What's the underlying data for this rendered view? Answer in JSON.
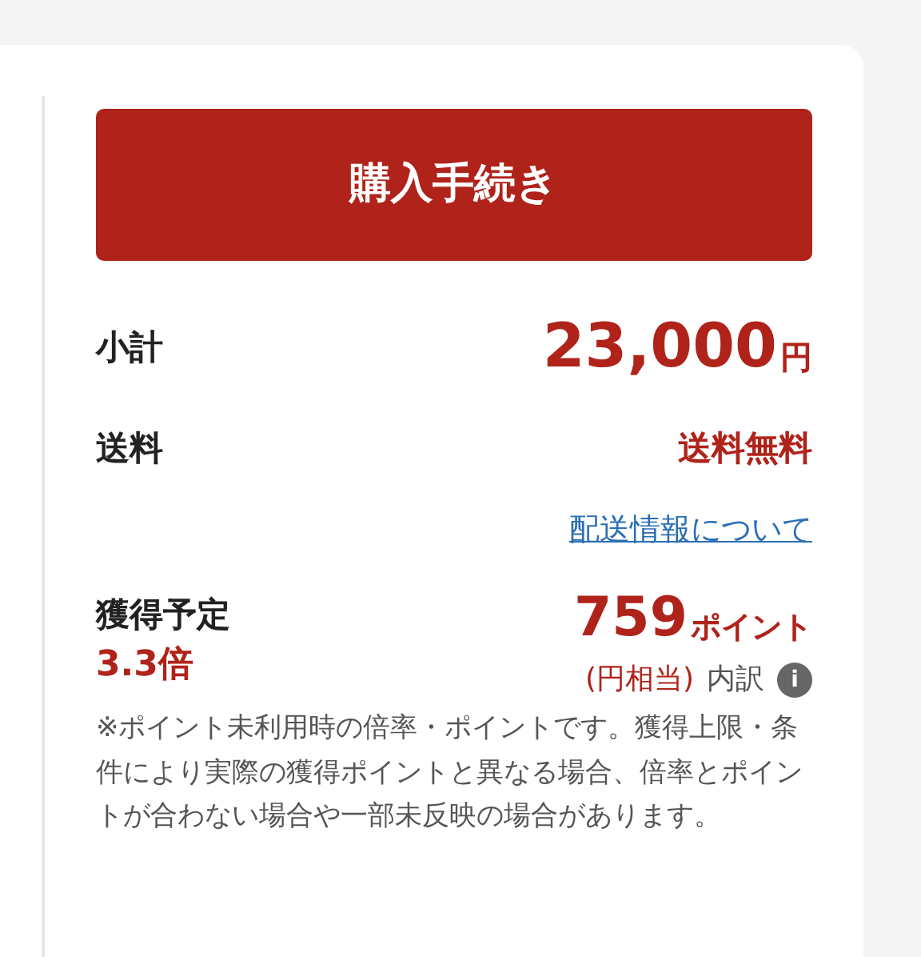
{
  "checkout_button": "購入手続き",
  "subtotal": {
    "label": "小計",
    "amount": "23,000",
    "unit": "円"
  },
  "shipping": {
    "label": "送料",
    "value": "送料無料"
  },
  "shipping_link": "配送情報について",
  "points": {
    "label": "獲得予定",
    "rate": "3.3倍",
    "amount": "759",
    "unit": "ポイント",
    "equivalent": "(円相当)",
    "breakdown": "内訳",
    "info_glyph": "i"
  },
  "note": "※ポイント未利用時の倍率・ポイントです。獲得上限・条件により実際の獲得ポイントと異なる場合、倍率とポイントが合わない場合や一部未反映の場合があります。"
}
